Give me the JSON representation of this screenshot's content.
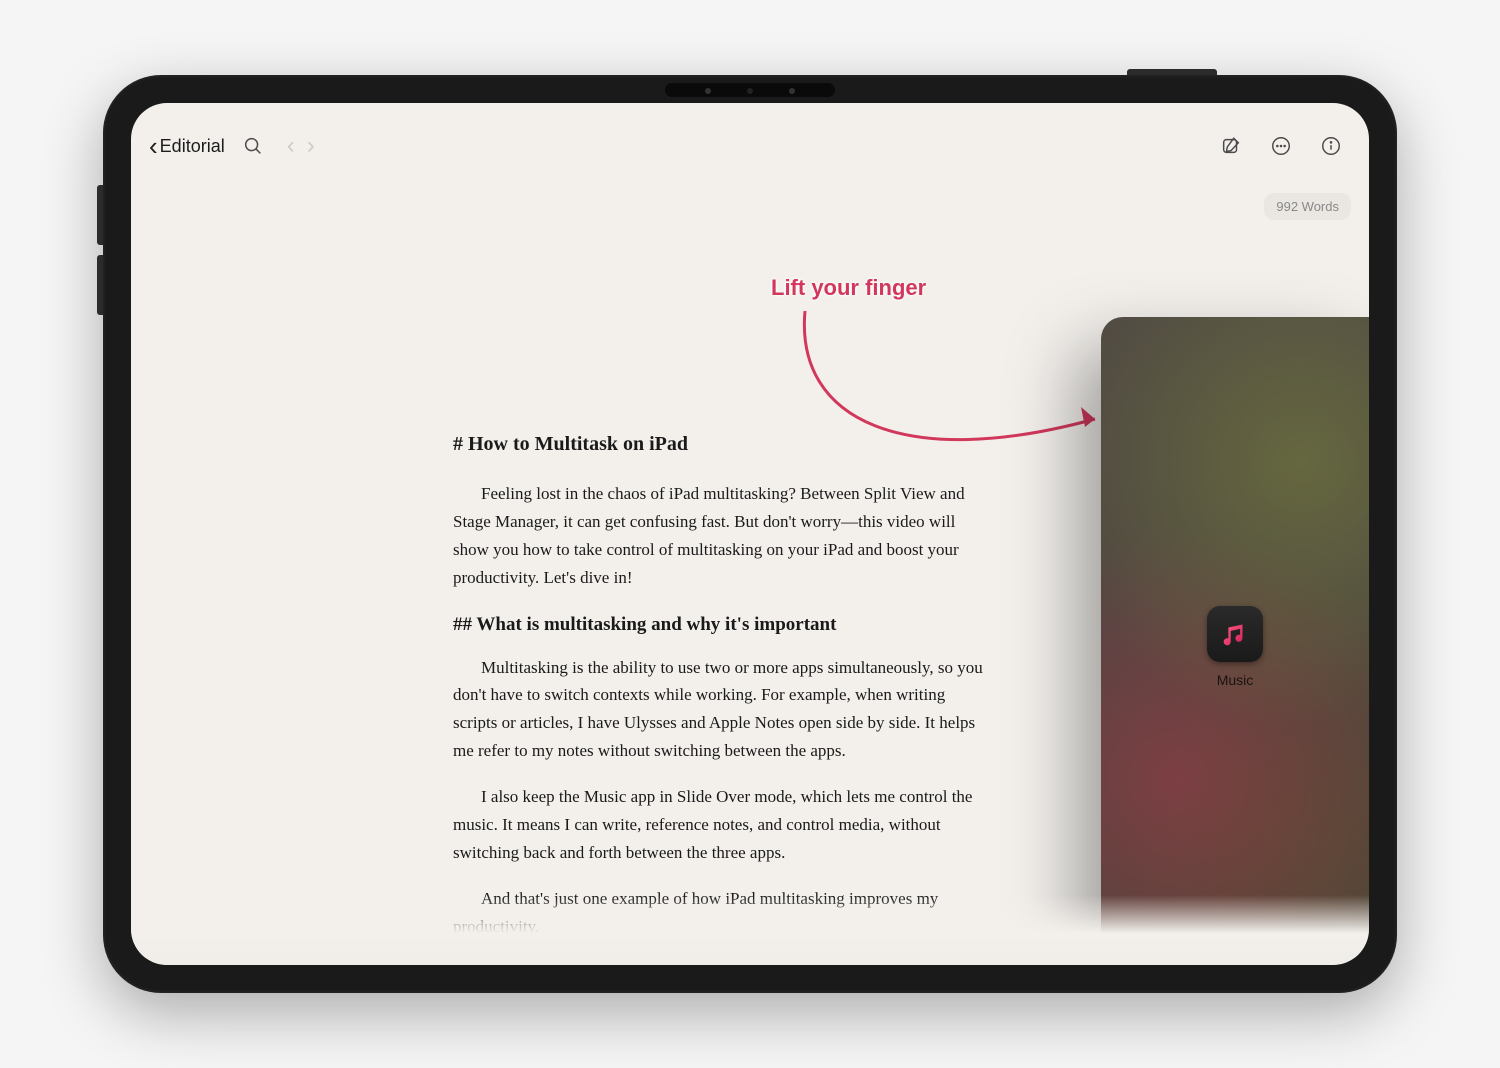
{
  "toolbar": {
    "back_label": "Editorial"
  },
  "word_count": "992 Words",
  "annotation_text": "Lift your finger",
  "slide_over": {
    "app_label": "Music"
  },
  "document": {
    "h1": "# How to Multitask on iPad",
    "p1": "Feeling lost in the chaos of iPad multitasking? Between Split View and Stage Manager, it can get confusing fast. But don't worry—this video will show you how to take control of multitasking on your iPad and boost your productivity. Let's dive in!",
    "h2": "## What is multitasking and why it's important",
    "p2": "Multitasking is the ability to use two or more apps simultaneously, so you don't have to switch contexts while working. For example, when writing scripts or articles, I have Ulysses and Apple Notes open side by side. It helps me refer to my notes without switching between the apps.",
    "p3": "I also keep the Music app in Slide Over mode, which lets me control the music. It means I can write, reference notes, and control media, without switching back and forth between the three apps.",
    "p4": "And that's just one example of how iPad multitasking improves my productivity."
  }
}
